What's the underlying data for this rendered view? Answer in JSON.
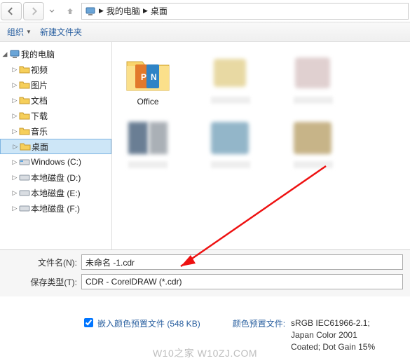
{
  "nav": {
    "computer": "我的电脑",
    "desktop": "桌面"
  },
  "toolbar": {
    "organize": "组织",
    "new_folder": "新建文件夹"
  },
  "tree": {
    "root": "我的电脑",
    "items": [
      "视频",
      "图片",
      "文档",
      "下载",
      "音乐",
      "桌面",
      "Windows (C:)",
      "本地磁盘 (D:)",
      "本地磁盘 (E:)",
      "本地磁盘 (F:)"
    ]
  },
  "folders": {
    "office": "Office"
  },
  "fields": {
    "filename_label": "文件名(N):",
    "filename_value": "未命名 -1.cdr",
    "savetype_label": "保存类型(T):",
    "savetype_value": "CDR - CorelDRAW (*.cdr)"
  },
  "embed": {
    "label": "嵌入颜色预置文件 (548 KB)"
  },
  "preset": {
    "label": "颜色预置文件:",
    "line1": "sRGB IEC61966-2.1;",
    "line2": "Japan Color 2001",
    "line3": "Coated; Dot Gain 15%"
  },
  "watermark": "W10之家 W10ZJ.COM"
}
